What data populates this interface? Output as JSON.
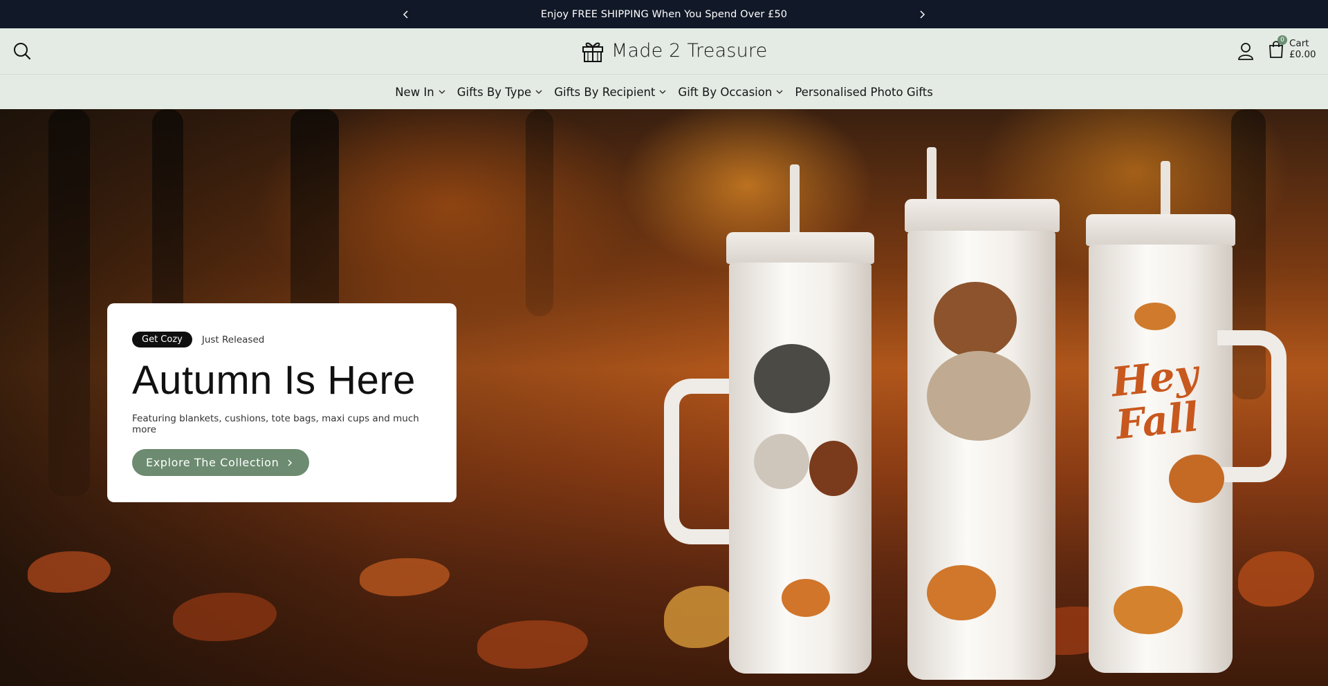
{
  "announcement": {
    "message": "Enjoy FREE SHIPPING When You Spend Over £50"
  },
  "header": {
    "brand": "Made 2 Treasure",
    "cart": {
      "count": "0",
      "label": "Cart",
      "total": "£0.00"
    }
  },
  "nav": {
    "items": [
      {
        "label": "New In",
        "dropdown": true
      },
      {
        "label": "Gifts By Type",
        "dropdown": true
      },
      {
        "label": "Gifts By Recipient",
        "dropdown": true
      },
      {
        "label": "Gift By Occasion",
        "dropdown": true
      },
      {
        "label": "Personalised Photo Gifts",
        "dropdown": false
      }
    ]
  },
  "hero": {
    "tag": "Get Cozy",
    "subtag": "Just Released",
    "title": "Autumn Is Here",
    "description": "Featuring blankets, cushions, tote bags, maxi cups and much more",
    "cta_label": "Explore The Collection",
    "tumbler_texts": [
      "Hey",
      "Fall"
    ]
  },
  "colors": {
    "announcement_bg": "#111827",
    "header_bg": "#e3ebe4",
    "accent": "#6c8b70",
    "pill_bg": "#0f0f0f"
  }
}
